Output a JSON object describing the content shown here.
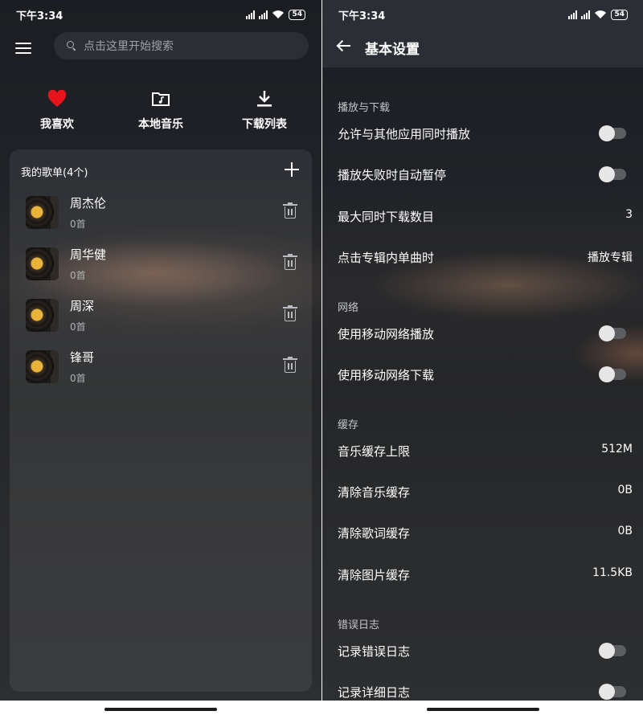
{
  "left": {
    "status": {
      "time": "下午3:34",
      "battery": "54"
    },
    "search": {
      "placeholder": "点击这里开始搜索"
    },
    "quick": [
      {
        "label": "我喜欢",
        "icon": "heart-icon"
      },
      {
        "label": "本地音乐",
        "icon": "music-folder-icon"
      },
      {
        "label": "下载列表",
        "icon": "download-icon"
      }
    ],
    "playlists": {
      "title": "我的歌单(4个)",
      "items": [
        {
          "name": "周杰伦",
          "count": "0首"
        },
        {
          "name": "周华健",
          "count": "0首"
        },
        {
          "name": "周深",
          "count": "0首"
        },
        {
          "name": "锋哥",
          "count": "0首"
        }
      ]
    },
    "colors": {
      "heart": "#e8141c",
      "accent_toggle_off": "#5c5e62"
    }
  },
  "right": {
    "status": {
      "time": "下午3:34",
      "battery": "54"
    },
    "title": "基本设置",
    "sections": {
      "playback": {
        "title": "播放与下载",
        "allow_mix": "允许与其他应用同时播放",
        "auto_pause": "播放失败时自动暂停",
        "max_downloads": "最大同时下载数目",
        "max_downloads_value": "3",
        "click_album": "点击专辑内单曲时",
        "click_album_value": "播放专辑"
      },
      "network": {
        "title": "网络",
        "mobile_play": "使用移动网络播放",
        "mobile_download": "使用移动网络下载"
      },
      "cache": {
        "title": "缓存",
        "limit": "音乐缓存上限",
        "limit_value": "512M",
        "clear_music": "清除音乐缓存",
        "clear_music_value": "0B",
        "clear_lyrics": "清除歌词缓存",
        "clear_lyrics_value": "0B",
        "clear_images": "清除图片缓存",
        "clear_images_value": "11.5KB"
      },
      "errors": {
        "title": "错误日志",
        "record": "记录错误日志",
        "record_detail": "记录详细日志"
      }
    },
    "toggles": {
      "allow_mix": false,
      "auto_pause": false,
      "mobile_play": false,
      "mobile_download": false,
      "record": false,
      "record_detail": false
    }
  }
}
